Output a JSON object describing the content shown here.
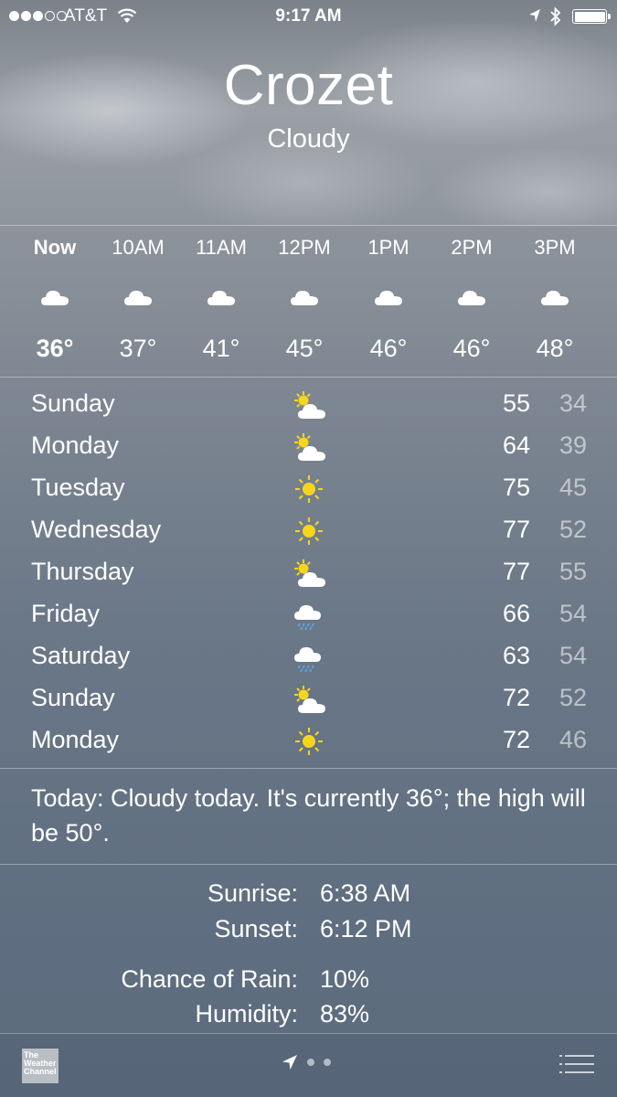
{
  "status": {
    "carrier": "AT&T",
    "time": "9:17 AM",
    "signal_bars": 3,
    "signal_total": 5,
    "battery_level": 1.0
  },
  "header": {
    "city": "Crozet",
    "condition": "Cloudy"
  },
  "hourly": [
    {
      "label": "Now",
      "temp": "36°",
      "icon": "cloud-icon"
    },
    {
      "label": "10AM",
      "temp": "37°",
      "icon": "cloud-icon"
    },
    {
      "label": "11AM",
      "temp": "41°",
      "icon": "cloud-icon"
    },
    {
      "label": "12PM",
      "temp": "45°",
      "icon": "cloud-icon"
    },
    {
      "label": "1PM",
      "temp": "46°",
      "icon": "cloud-icon"
    },
    {
      "label": "2PM",
      "temp": "46°",
      "icon": "cloud-icon"
    },
    {
      "label": "3PM",
      "temp": "48°",
      "icon": "cloud-icon"
    }
  ],
  "daily": [
    {
      "day": "Sunday",
      "icon": "partly-sunny-icon",
      "high": "55",
      "low": "34"
    },
    {
      "day": "Monday",
      "icon": "partly-sunny-icon",
      "high": "64",
      "low": "39"
    },
    {
      "day": "Tuesday",
      "icon": "sun-icon",
      "high": "75",
      "low": "45"
    },
    {
      "day": "Wednesday",
      "icon": "sun-icon",
      "high": "77",
      "low": "52"
    },
    {
      "day": "Thursday",
      "icon": "partly-sunny-icon",
      "high": "77",
      "low": "55"
    },
    {
      "day": "Friday",
      "icon": "rain-icon",
      "high": "66",
      "low": "54"
    },
    {
      "day": "Saturday",
      "icon": "rain-icon",
      "high": "63",
      "low": "54"
    },
    {
      "day": "Sunday",
      "icon": "partly-sunny-icon",
      "high": "72",
      "low": "52"
    },
    {
      "day": "Monday",
      "icon": "sun-icon",
      "high": "72",
      "low": "46"
    }
  ],
  "summary": "Today: Cloudy today. It's currently 36°; the high will be 50°.",
  "details": {
    "sunrise_label": "Sunrise:",
    "sunrise_value": "6:38 AM",
    "sunset_label": "Sunset:",
    "sunset_value": "6:12 PM",
    "rain_label": "Chance of Rain:",
    "rain_value": "10%",
    "humidity_label": "Humidity:",
    "humidity_value": "83%"
  },
  "footer": {
    "logo_text": "The Weather Channel"
  },
  "colors": {
    "sun": "#f7d51d",
    "rain": "#5aa7e6",
    "cloud": "#ffffff"
  }
}
